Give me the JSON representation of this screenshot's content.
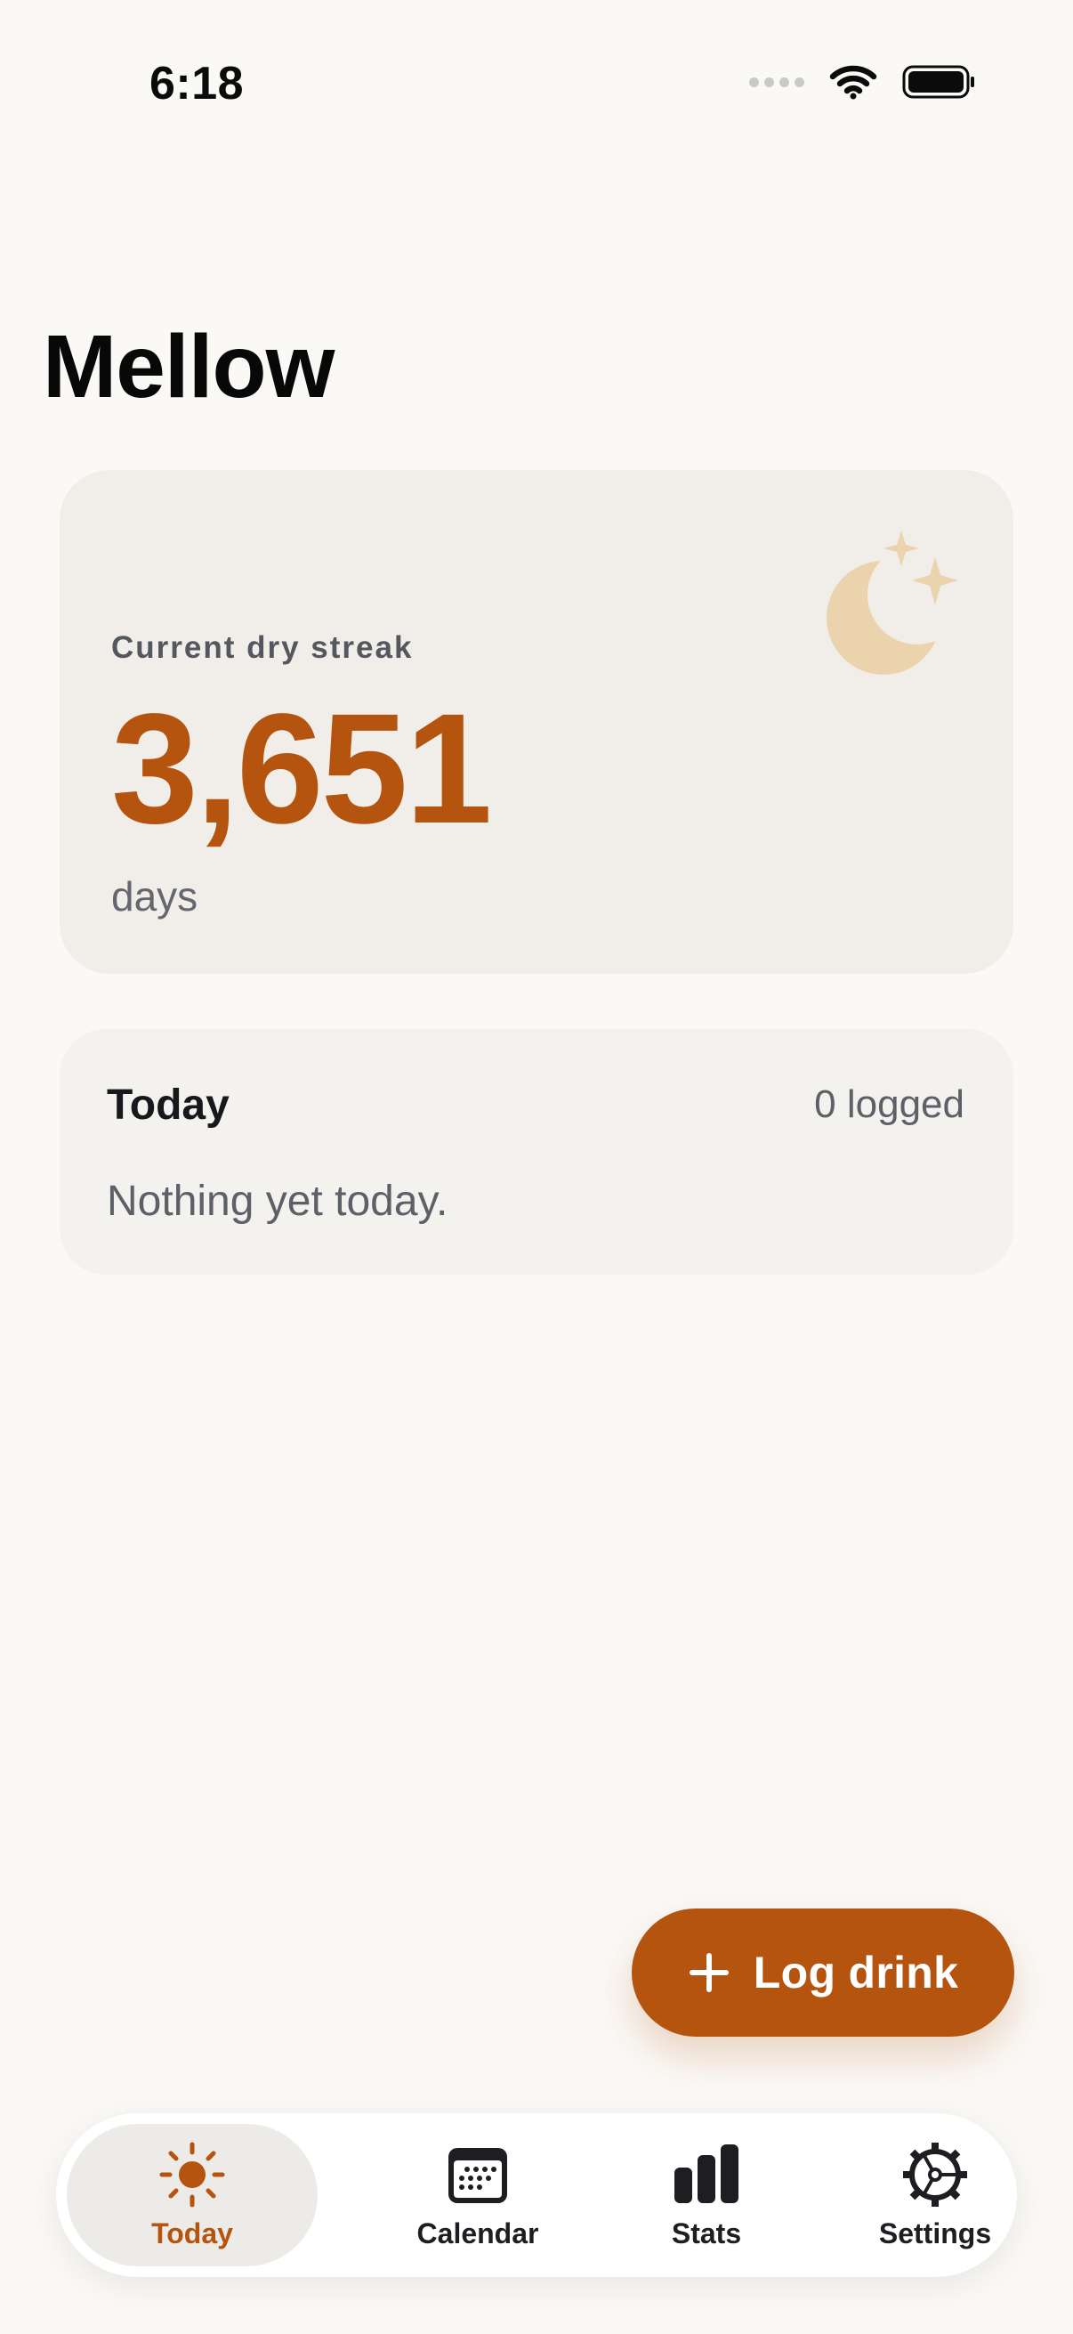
{
  "status_bar": {
    "time": "6:18"
  },
  "app": {
    "title": "Mellow"
  },
  "streak": {
    "label": "Current dry streak",
    "value": "3,651",
    "unit": "days",
    "icon": "moon-stars-icon"
  },
  "today": {
    "title": "Today",
    "count": "0 logged",
    "empty_message": "Nothing yet today."
  },
  "actions": {
    "log_drink": "Log drink",
    "log_drink_icon": "plus-icon"
  },
  "tabs": [
    {
      "label": "Today",
      "icon": "sun-icon",
      "active": true
    },
    {
      "label": "Calendar",
      "icon": "calendar-icon",
      "active": false
    },
    {
      "label": "Stats",
      "icon": "bar-chart-icon",
      "active": false
    },
    {
      "label": "Settings",
      "icon": "gear-icon",
      "active": false
    }
  ],
  "colors": {
    "accent": "#B5540F",
    "background": "#FAF9F6",
    "card": "#F1EDE8",
    "moon": "#EBD3AE"
  }
}
